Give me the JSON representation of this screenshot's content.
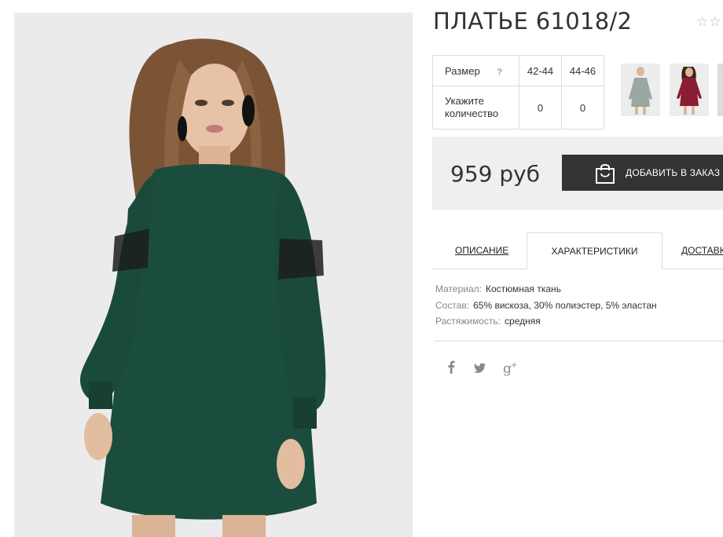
{
  "product": {
    "title": "ПЛАТЬЕ 61018/2",
    "rating_stars": "☆☆"
  },
  "size_table": {
    "size_label": "Размер",
    "help_mark": "?",
    "sizes": [
      "42-44",
      "44-46"
    ],
    "qty_label_line1": "Укажите",
    "qty_label_line2": "количество",
    "quantities": [
      "0",
      "0"
    ]
  },
  "price": {
    "value": "959 руб",
    "add_button": "ДОБАВИТЬ В ЗАКАЗ"
  },
  "tabs": {
    "description": "ОПИСАНИЕ",
    "characteristics": "ХАРАКТЕРИСТИКИ",
    "delivery": "ДОСТАВКА"
  },
  "characteristics": [
    {
      "key": "Материал:",
      "value": "Костюмная ткань"
    },
    {
      "key": "Состав:",
      "value": "65% вискоза, 30% полиэстер, 5% эластан"
    },
    {
      "key": "Растяжимость:",
      "value": "средняя"
    }
  ],
  "social": [
    "facebook-icon",
    "twitter-icon",
    "google-plus-icon"
  ],
  "colors": {
    "dress_main": "#1b4d3e",
    "dress_alt": "#8a1d33",
    "button_bg": "#333333",
    "price_bg": "#efefef"
  }
}
